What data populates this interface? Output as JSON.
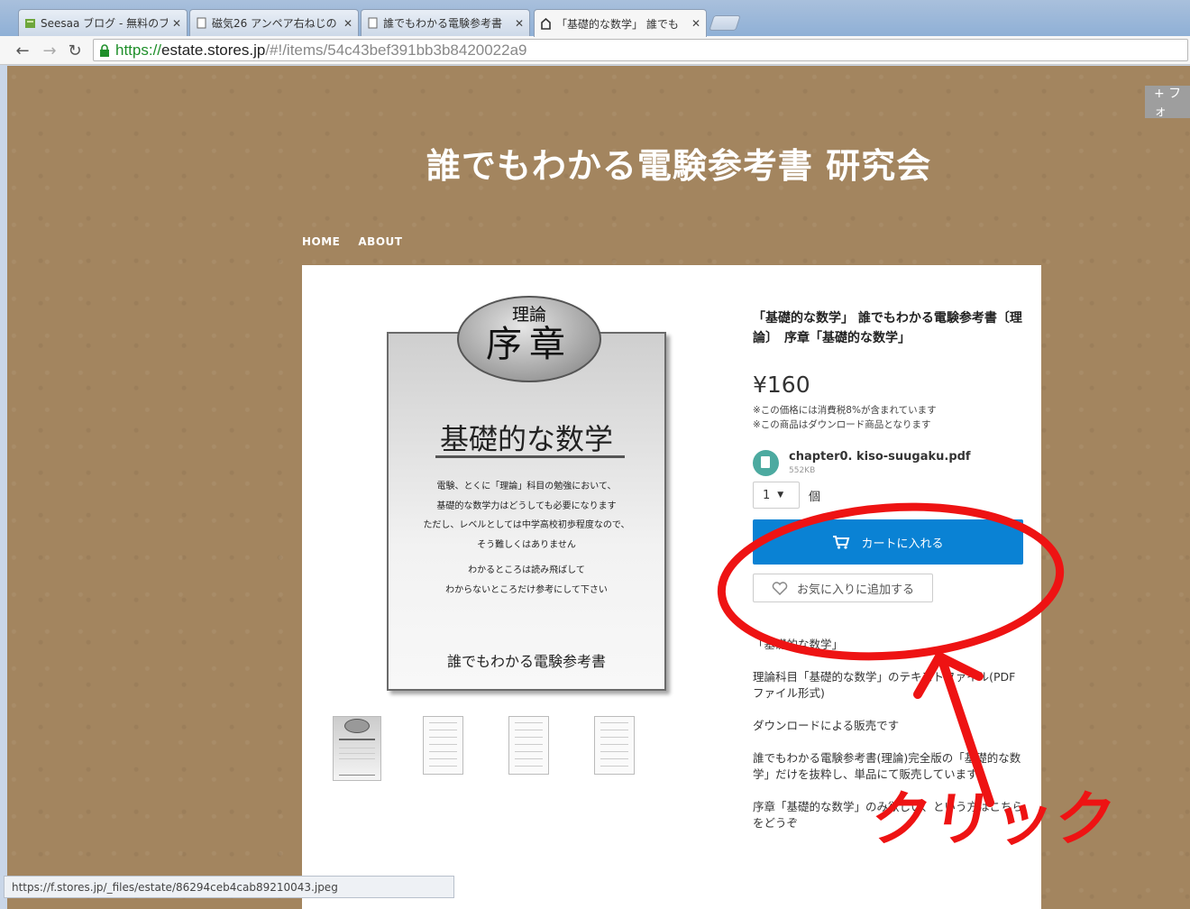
{
  "tabs": [
    {
      "title": "Seesaa ブログ - 無料のブ",
      "favicon": "seesaa-icon",
      "active": false
    },
    {
      "title": "磁気26 アンペア右ねじの",
      "favicon": "page-icon",
      "active": false
    },
    {
      "title": "誰でもわかる電験参考書",
      "favicon": "page-icon",
      "active": false
    },
    {
      "title": "「基礎的な数学」 誰でも",
      "favicon": "stores-icon",
      "active": true
    }
  ],
  "address": {
    "scheme": "https://",
    "host": "estate.stores.jp",
    "path": "/#!/items/54c43bef391bb3b8420022a9"
  },
  "page": {
    "follow_label": "+ フォ",
    "shop_title": "誰でもわかる電験参考書 研究会",
    "nav": [
      "HOME",
      "ABOUT"
    ]
  },
  "cover": {
    "badge_small": "理論",
    "badge_big": "序章",
    "main_title": "基礎的な数学",
    "lines": [
      "電験、とくに「理論」科目の勉強において、",
      "基礎的な数学力はどうしても必要になります",
      "ただし、レベルとしては中学高校初歩程度なので、",
      "そう難しくはありません",
      "わかるところは読み飛ばして",
      "わからないところだけ参考にして下さい"
    ],
    "footer": "誰でもわかる電験参考書"
  },
  "product": {
    "title": "「基礎的な数学」 誰でもわかる電験参考書〔理論〕　序章「基礎的な数学」",
    "price": "¥160",
    "tax_note": "※この価格には消費税8%が含まれています",
    "download_note": "※この商品はダウンロード商品となります",
    "file_name": "chapter0. kiso-suugaku.pdf",
    "file_size": "552KB",
    "quantity": "1",
    "quantity_unit": "個",
    "cart_label": "カートに入れる",
    "favorite_label": "お気に入りに追加する",
    "description": [
      "「基礎的な数学」",
      "理論科目「基礎的な数学」のテキストファイル(PDFファイル形式)",
      "ダウンロードによる販売です",
      "誰でもわかる電験参考書(理論)完全版の「基礎的な数学」だけを抜粋し、単品にて販売しています",
      "序章「基礎的な数学」のみ欲しい、という方はこちらをどうぞ"
    ]
  },
  "annotation": {
    "label": "クリック",
    "color": "#ee1313"
  },
  "status_url": "https://f.stores.jp/_files/estate/86294ceb4cab89210043.jpeg"
}
